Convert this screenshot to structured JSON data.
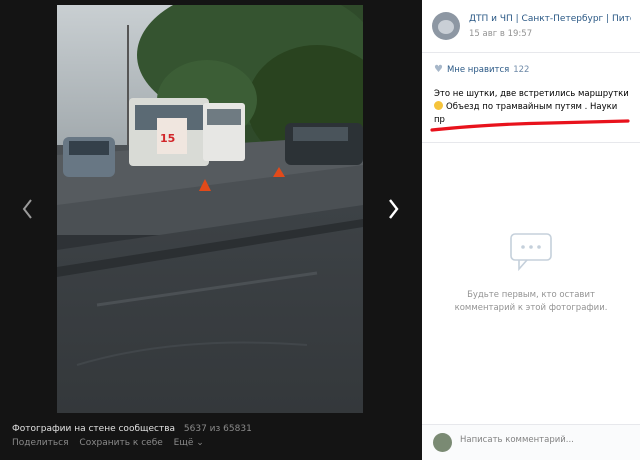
{
  "viewer": {
    "photo_alt": "",
    "bus_sign": "15",
    "footer": {
      "album_title": "Фотографии на стене сообщества",
      "counter": "5637 из 65831",
      "share_label": "Поделиться",
      "save_label": "Сохранить к себе",
      "more_label": "Ещё ⌄"
    }
  },
  "panel": {
    "header": {
      "community_name": "ДТП и ЧП | Санкт-Петербург | Пите…",
      "date": "15 авг в 19:57"
    },
    "likes": {
      "label": "Мне нравится",
      "count": "122"
    },
    "description": {
      "line1": "Это не шутки, две встретились маршрутки",
      "line2": "Объезд по трамвайным путям . Науки",
      "line3": "пр"
    },
    "comments_empty": {
      "text_line1": "Будьте первым, кто оставит",
      "text_line2": "комментарий к этой фотографии."
    },
    "comment_input": {
      "placeholder": "Написать комментарий..."
    }
  },
  "colors": {
    "link": "#2a5885",
    "viewer_bg": "#141414",
    "annotation_red": "#e8121c"
  }
}
